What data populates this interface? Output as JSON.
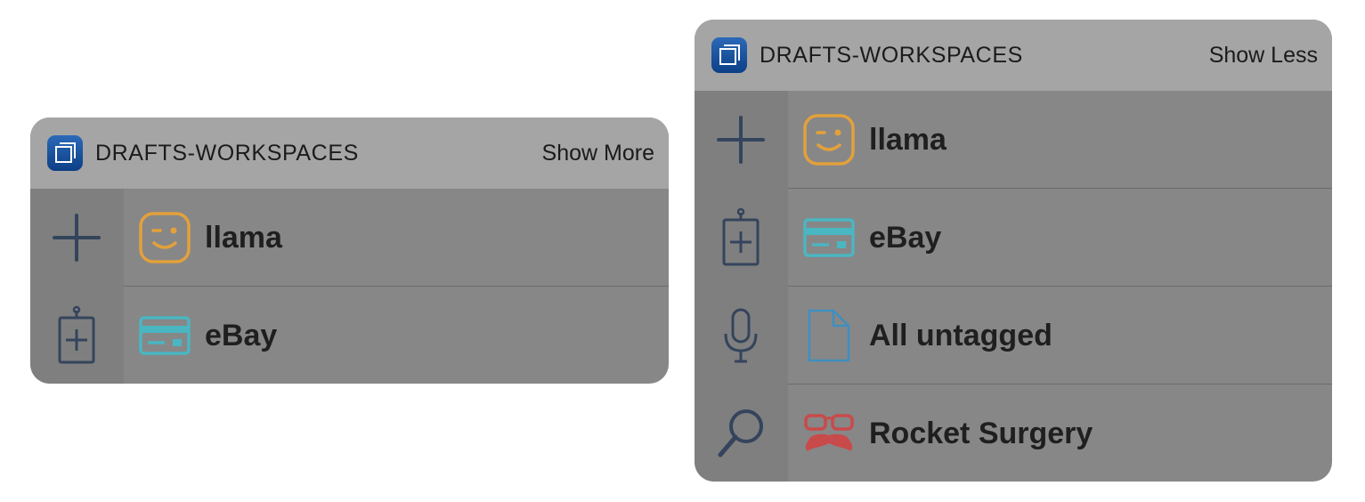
{
  "colors": {
    "header_bg": "#a5a5a5",
    "widget_bg": "#878787",
    "action_column_bg": "#7f7f7f",
    "action_icon": "#34445c",
    "app_icon_blue": "#1a4f9e",
    "llama_icon": "#e3a13b",
    "ebay_icon": "#4ab6c2",
    "untagged_icon": "#3f8fbd",
    "rocket_icon": "#c94a4a"
  },
  "widget_collapsed": {
    "app_name": "DRAFTS-WORKSPACES",
    "toggle_label": "Show More",
    "app_icon": "drafts-app-icon",
    "actions": [
      {
        "icon": "plus-icon"
      },
      {
        "icon": "clipboard-plus-icon"
      }
    ],
    "rows": [
      {
        "label": "llama",
        "icon": "winking-face-icon"
      },
      {
        "label": "eBay",
        "icon": "credit-card-icon"
      }
    ]
  },
  "widget_expanded": {
    "app_name": "DRAFTS-WORKSPACES",
    "toggle_label": "Show Less",
    "app_icon": "drafts-app-icon",
    "actions": [
      {
        "icon": "plus-icon"
      },
      {
        "icon": "clipboard-plus-icon"
      },
      {
        "icon": "microphone-icon"
      },
      {
        "icon": "search-icon"
      }
    ],
    "rows": [
      {
        "label": "llama",
        "icon": "winking-face-icon"
      },
      {
        "label": "eBay",
        "icon": "credit-card-icon"
      },
      {
        "label": "All untagged",
        "icon": "document-icon"
      },
      {
        "label": "Rocket Surgery",
        "icon": "glasses-mustache-icon"
      }
    ]
  }
}
